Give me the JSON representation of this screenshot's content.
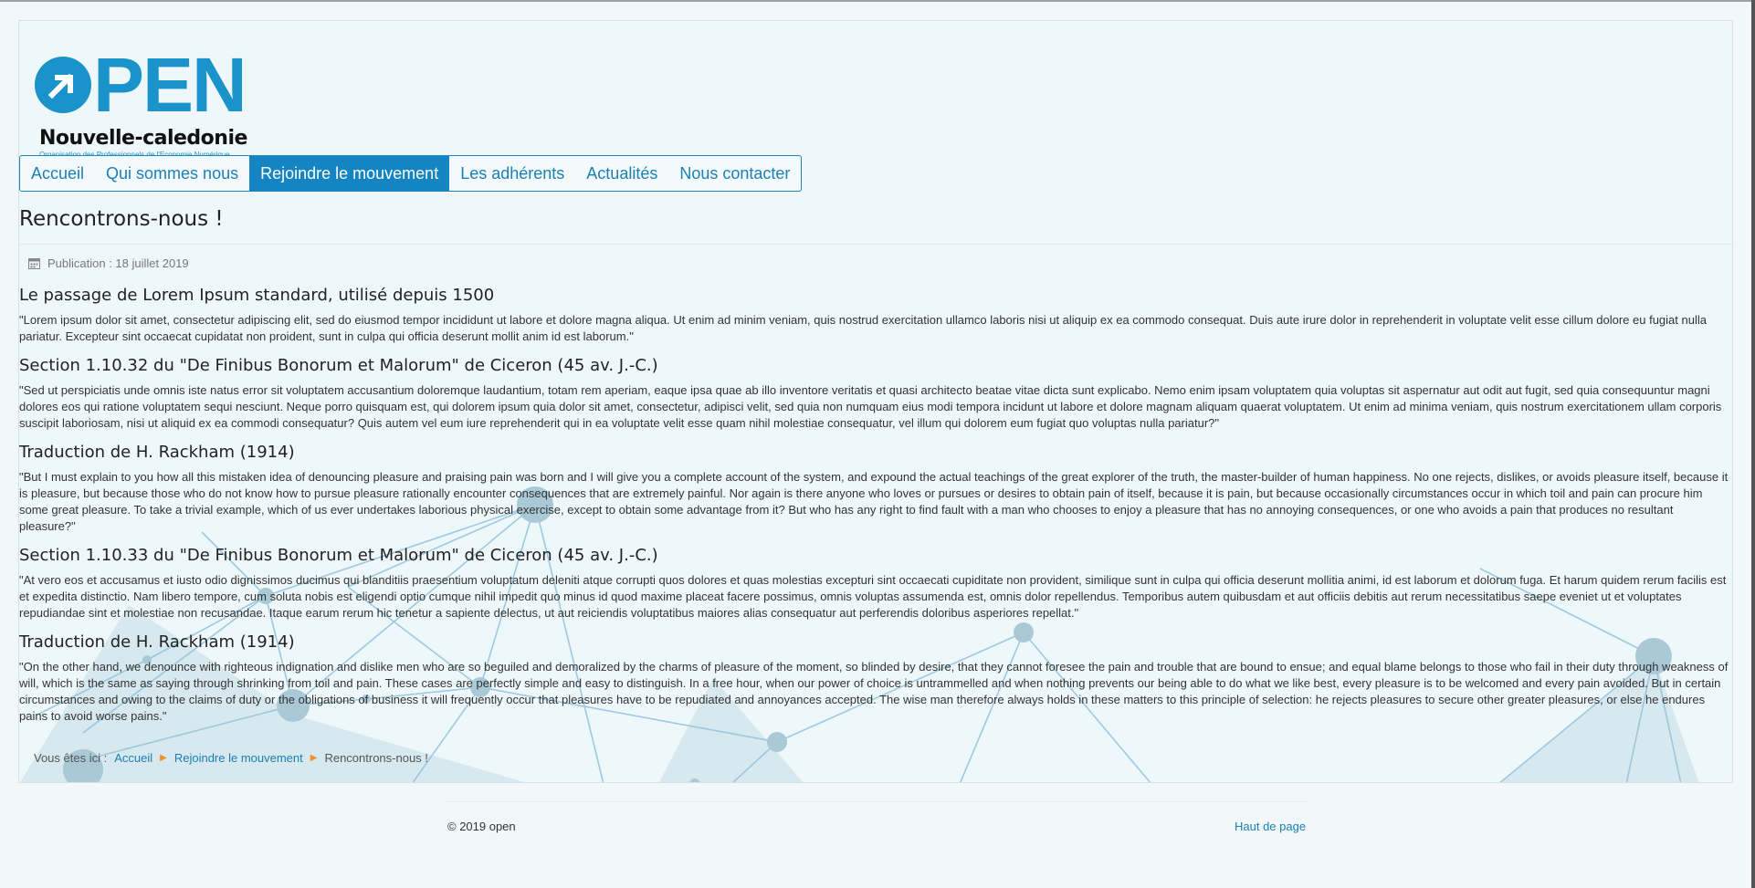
{
  "logo": {
    "word_rest": "PEN",
    "name": "Nouvelle-caledonie",
    "tagline": "Organisation des Professionnels de l'Economie Numérique"
  },
  "nav": {
    "items": [
      {
        "label": "Accueil"
      },
      {
        "label": "Qui sommes nous"
      },
      {
        "label": "Rejoindre le mouvement"
      },
      {
        "label": "Les adhérents"
      },
      {
        "label": "Actualités"
      },
      {
        "label": "Nous contacter"
      }
    ],
    "active_index": 2
  },
  "page": {
    "title": "Rencontrons-nous !",
    "publication": "Publication : 18 juillet 2019"
  },
  "article": {
    "sections": [
      {
        "heading": "Le passage de Lorem Ipsum standard, utilisé depuis 1500",
        "text": "\"Lorem ipsum dolor sit amet, consectetur adipiscing elit, sed do eiusmod tempor incididunt ut labore et dolore magna aliqua. Ut enim ad minim veniam, quis nostrud exercitation ullamco laboris nisi ut aliquip ex ea commodo consequat. Duis aute irure dolor in reprehenderit in voluptate velit esse cillum dolore eu fugiat nulla pariatur. Excepteur sint occaecat cupidatat non proident, sunt in culpa qui officia deserunt mollit anim id est laborum.\""
      },
      {
        "heading": "Section 1.10.32 du \"De Finibus Bonorum et Malorum\" de Ciceron (45 av. J.-C.)",
        "text": "\"Sed ut perspiciatis unde omnis iste natus error sit voluptatem accusantium doloremque laudantium, totam rem aperiam, eaque ipsa quae ab illo inventore veritatis et quasi architecto beatae vitae dicta sunt explicabo. Nemo enim ipsam voluptatem quia voluptas sit aspernatur aut odit aut fugit, sed quia consequuntur magni dolores eos qui ratione voluptatem sequi nesciunt. Neque porro quisquam est, qui dolorem ipsum quia dolor sit amet, consectetur, adipisci velit, sed quia non numquam eius modi tempora incidunt ut labore et dolore magnam aliquam quaerat voluptatem. Ut enim ad minima veniam, quis nostrum exercitationem ullam corporis suscipit laboriosam, nisi ut aliquid ex ea commodi consequatur? Quis autem vel eum iure reprehenderit qui in ea voluptate velit esse quam nihil molestiae consequatur, vel illum qui dolorem eum fugiat quo voluptas nulla pariatur?\""
      },
      {
        "heading": "Traduction de H. Rackham (1914)",
        "text": "\"But I must explain to you how all this mistaken idea of denouncing pleasure and praising pain was born and I will give you a complete account of the system, and expound the actual teachings of the great explorer of the truth, the master-builder of human happiness. No one rejects, dislikes, or avoids pleasure itself, because it is pleasure, but because those who do not know how to pursue pleasure rationally encounter consequences that are extremely painful. Nor again is there anyone who loves or pursues or desires to obtain pain of itself, because it is pain, but because occasionally circumstances occur in which toil and pain can procure him some great pleasure. To take a trivial example, which of us ever undertakes laborious physical exercise, except to obtain some advantage from it? But who has any right to find fault with a man who chooses to enjoy a pleasure that has no annoying consequences, or one who avoids a pain that produces no resultant pleasure?\""
      },
      {
        "heading": "Section 1.10.33 du \"De Finibus Bonorum et Malorum\" de Ciceron (45 av. J.-C.)",
        "text": "\"At vero eos et accusamus et iusto odio dignissimos ducimus qui blanditiis praesentium voluptatum deleniti atque corrupti quos dolores et quas molestias excepturi sint occaecati cupiditate non provident, similique sunt in culpa qui officia deserunt mollitia animi, id est laborum et dolorum fuga. Et harum quidem rerum facilis est et expedita distinctio. Nam libero tempore, cum soluta nobis est eligendi optio cumque nihil impedit quo minus id quod maxime placeat facere possimus, omnis voluptas assumenda est, omnis dolor repellendus. Temporibus autem quibusdam et aut officiis debitis aut rerum necessitatibus saepe eveniet ut et voluptates repudiandae sint et molestiae non recusandae. Itaque earum rerum hic tenetur a sapiente delectus, ut aut reiciendis voluptatibus maiores alias consequatur aut perferendis doloribus asperiores repellat.\""
      },
      {
        "heading": "Traduction de H. Rackham (1914)",
        "text": "\"On the other hand, we denounce with righteous indignation and dislike men who are so beguiled and demoralized by the charms of pleasure of the moment, so blinded by desire, that they cannot foresee the pain and trouble that are bound to ensue; and equal blame belongs to those who fail in their duty through weakness of will, which is the same as saying through shrinking from toil and pain. These cases are perfectly simple and easy to distinguish. In a free hour, when our power of choice is untrammelled and when nothing prevents our being able to do what we like best, every pleasure is to be welcomed and every pain avoided. But in certain circumstances and owing to the claims of duty or the obligations of business it will frequently occur that pleasures have to be repudiated and annoyances accepted. The wise man therefore always holds in these matters to this principle of selection: he rejects pleasures to secure other greater pleasures, or else he endures pains to avoid worse pains.\""
      }
    ]
  },
  "breadcrumb": {
    "prefix": "Vous êtes ici :",
    "items": [
      "Accueil",
      "Rejoindre le mouvement"
    ],
    "current": "Rencontrons-nous !"
  },
  "footer": {
    "copyright": "© 2019 open",
    "top_link": "Haut de page"
  },
  "colors": {
    "brand": "#1993c9",
    "nav_active": "#1584c2",
    "link": "#1a7fb5",
    "breadcrumb_arrow": "#f0902c"
  }
}
